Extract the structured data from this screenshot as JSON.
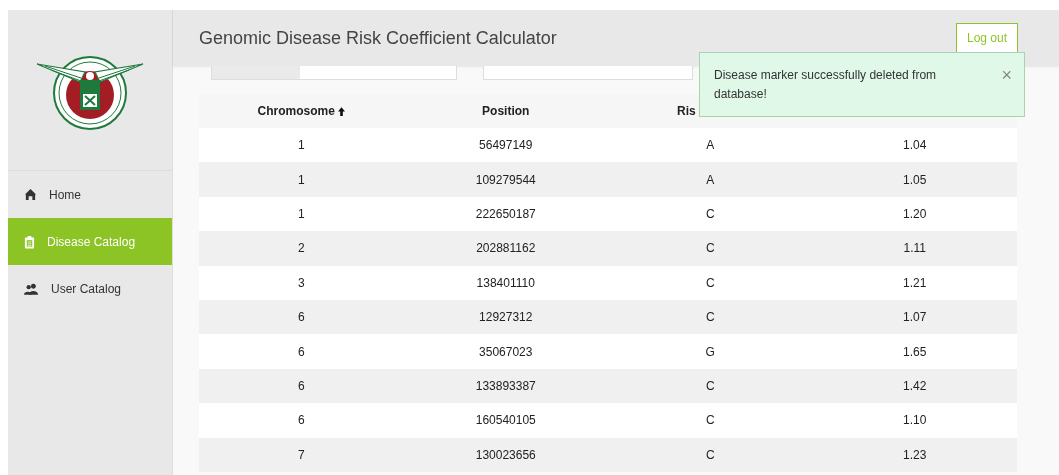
{
  "sidebar": {
    "items": [
      {
        "label": "Home",
        "selected": false
      },
      {
        "label": "Disease Catalog",
        "selected": true
      },
      {
        "label": "User Catalog",
        "selected": false
      }
    ]
  },
  "header": {
    "title": "Genomic Disease Risk Coefficient Calculator",
    "logout": "Log out"
  },
  "toast": {
    "message": "Disease marker successfully deleted from database!",
    "close": "×"
  },
  "table": {
    "columns": [
      {
        "label": "Chromosome",
        "sorted": true
      },
      {
        "label": "Position",
        "sorted": false
      },
      {
        "label": "Ris"
      }
    ],
    "rows": [
      [
        "1",
        "56497149",
        "A",
        "1.04"
      ],
      [
        "1",
        "109279544",
        "A",
        "1.05"
      ],
      [
        "1",
        "222650187",
        "C",
        "1.20"
      ],
      [
        "2",
        "202881162",
        "C",
        "1.11"
      ],
      [
        "3",
        "138401110",
        "C",
        "1.21"
      ],
      [
        "6",
        "12927312",
        "C",
        "1.07"
      ],
      [
        "6",
        "35067023",
        "G",
        "1.65"
      ],
      [
        "6",
        "133893387",
        "C",
        "1.42"
      ],
      [
        "6",
        "160540105",
        "C",
        "1.10"
      ],
      [
        "7",
        "130023656",
        "C",
        "1.23"
      ]
    ]
  }
}
